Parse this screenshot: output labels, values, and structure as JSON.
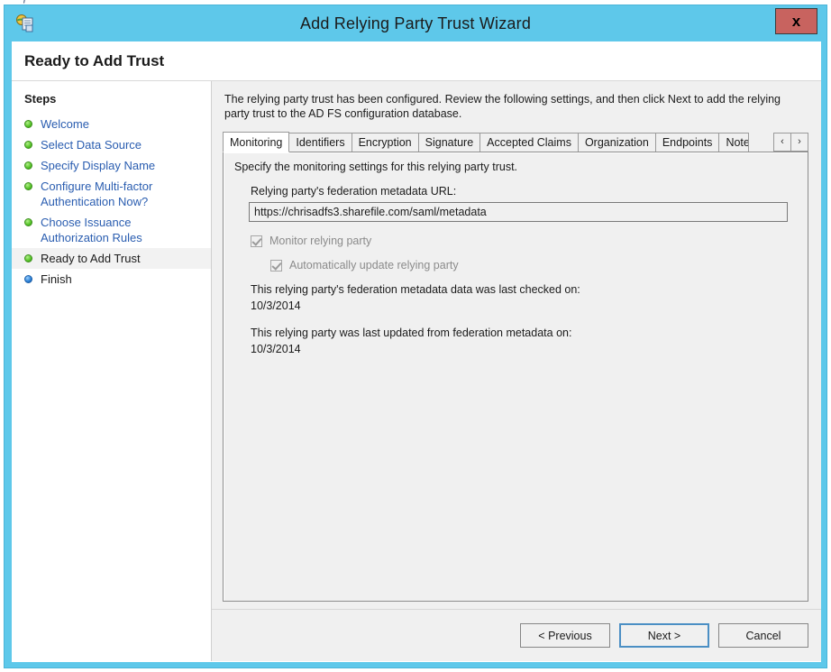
{
  "window": {
    "title": "Add Relying Party Trust Wizard",
    "close_label": "x",
    "icon": "adfs-relying-party-icon",
    "accent_color": "#5ec8ea",
    "close_color": "#c8635f"
  },
  "stray_fragment": "f",
  "page": {
    "heading": "Ready to Add Trust",
    "intro": "The relying party trust has been configured. Review the following settings, and then click Next to add the relying party trust to the AD FS configuration database."
  },
  "sidebar": {
    "title": "Steps",
    "items": [
      {
        "label": "Welcome",
        "state": "done"
      },
      {
        "label": "Select Data Source",
        "state": "done"
      },
      {
        "label": "Specify Display Name",
        "state": "done"
      },
      {
        "label": "Configure Multi-factor\nAuthentication Now?",
        "state": "done"
      },
      {
        "label": "Choose Issuance\nAuthorization Rules",
        "state": "done"
      },
      {
        "label": "Ready to Add Trust",
        "state": "current"
      },
      {
        "label": "Finish",
        "state": "pending"
      }
    ]
  },
  "tabs": {
    "items": [
      {
        "label": "Monitoring",
        "active": true
      },
      {
        "label": "Identifiers",
        "active": false
      },
      {
        "label": "Encryption",
        "active": false
      },
      {
        "label": "Signature",
        "active": false
      },
      {
        "label": "Accepted Claims",
        "active": false
      },
      {
        "label": "Organization",
        "active": false
      },
      {
        "label": "Endpoints",
        "active": false
      },
      {
        "label": "Notes",
        "active": false,
        "clipped": true
      }
    ],
    "scroll_prev": "‹",
    "scroll_next": "›"
  },
  "monitoring": {
    "description": "Specify the monitoring settings for this relying party trust.",
    "url_label": "Relying party's federation metadata URL:",
    "url_value": "https://chrisadfs3.sharefile.com/saml/metadata",
    "monitor_checkbox": {
      "label": "Monitor relying party",
      "checked": true,
      "disabled": true
    },
    "auto_update_checkbox": {
      "label": "Automatically update relying party",
      "checked": true,
      "disabled": true
    },
    "last_checked_label": "This relying party's federation metadata data was last checked on:",
    "last_checked_value": "10/3/2014",
    "last_updated_label": "This relying party was last updated from federation metadata on:",
    "last_updated_value": "10/3/2014"
  },
  "footer": {
    "previous_label": "< Previous",
    "next_label": "Next >",
    "cancel_label": "Cancel"
  }
}
